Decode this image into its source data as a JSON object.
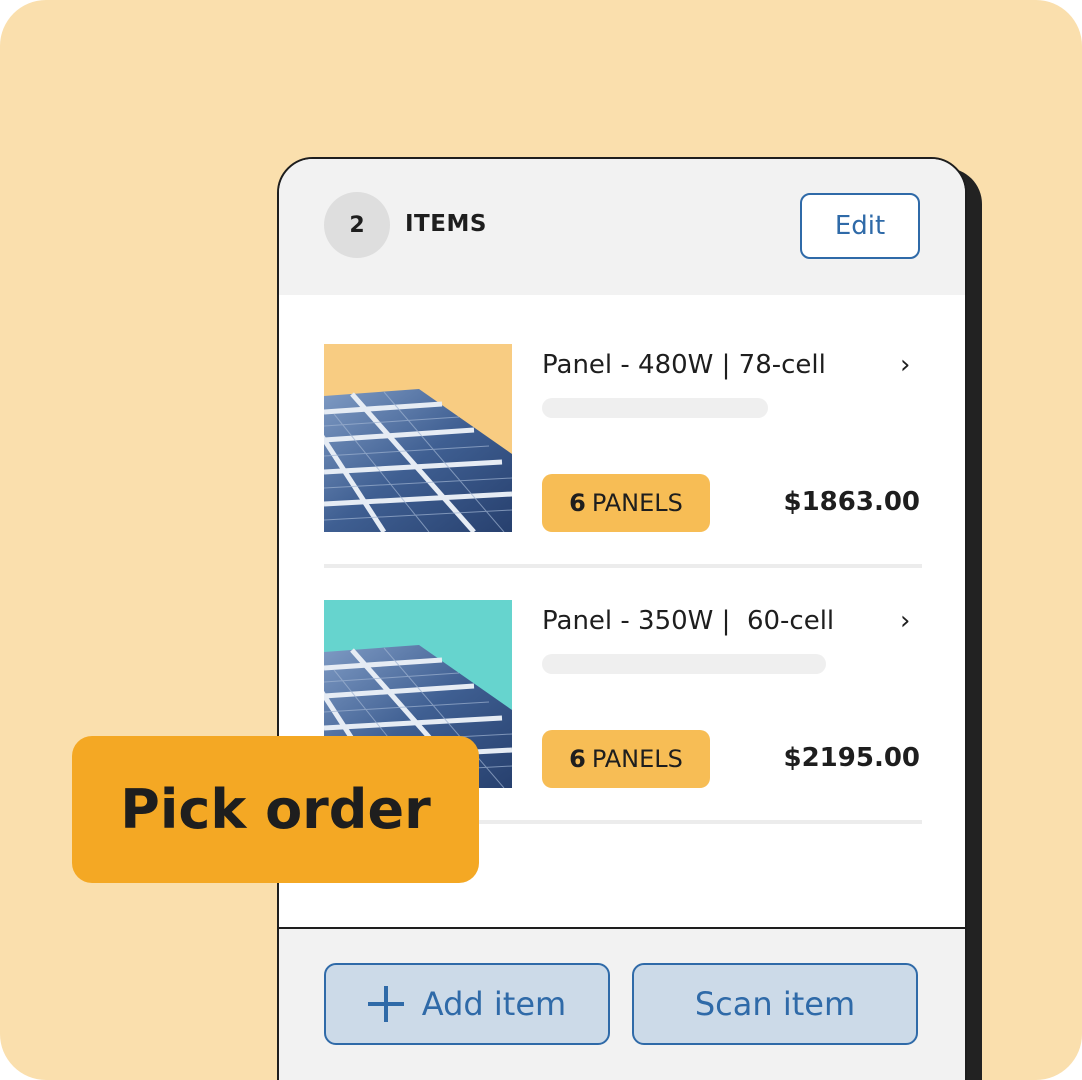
{
  "colors": {
    "background": "#fadfad",
    "accent_blue": "#2f6aa8",
    "badge_orange": "#f7bd55",
    "pick_order_orange": "#f4a824",
    "thumb1_bg": "#f8cc82",
    "thumb2_bg": "#66d4ce"
  },
  "header": {
    "item_count": "2",
    "items_label": "ITEMS",
    "edit_label": "Edit"
  },
  "items": [
    {
      "title": "Panel - 480W | 78-cell",
      "quantity": "6",
      "unit": "PANELS",
      "price": "$1863.00",
      "chevron_icon": "chevron-right-icon",
      "thumbnail": "solar-panel-image"
    },
    {
      "title": "Panel - 350W |  60-cell",
      "quantity": "6",
      "unit": "PANELS",
      "price": "$2195.00",
      "chevron_icon": "chevron-right-icon",
      "thumbnail": "solar-panel-image"
    }
  ],
  "footer": {
    "add_label": "Add item",
    "add_icon": "plus-icon",
    "scan_label": "Scan item"
  },
  "badge": {
    "label": "Pick order"
  }
}
